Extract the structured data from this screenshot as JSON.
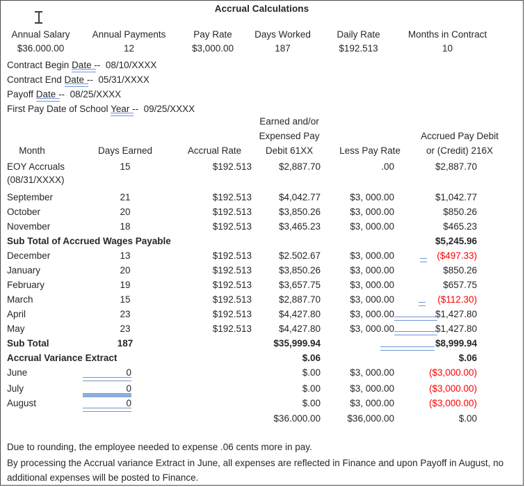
{
  "document": {
    "title": "Accrual Calculations"
  },
  "summary": {
    "headers": [
      "Annual Salary",
      "Annual Payments",
      "Pay Rate",
      "Days Worked",
      "Daily Rate",
      "Months in Contract"
    ],
    "values": [
      "$36.000.00",
      "12",
      "$3,000.00",
      "187",
      "$192.513",
      "10"
    ]
  },
  "dates": [
    {
      "label_before": "Contract Begin ",
      "marked": "Date",
      "sep": " --",
      "value": "08/10/XXXX"
    },
    {
      "label_before": "Contract End ",
      "marked": "Date",
      "sep": " --",
      "value": "05/31/XXXX"
    },
    {
      "label_before": "Payoff ",
      "marked": "Date",
      "sep": " --",
      "value": "08/25/XXXX"
    },
    {
      "label_before": "First Pay Date of School ",
      "marked": "Year",
      "sep": " --",
      "value": "09/25/XXXX"
    }
  ],
  "table": {
    "headers": {
      "month": "Month",
      "days_earned": "Days Earned",
      "accrual_rate": "Accrual Rate",
      "earned_line1": "Earned and/or",
      "earned_line2": "Expensed Pay",
      "earned_line3": "Debit 61XX",
      "less_pay_rate": "Less Pay Rate",
      "accrued_line1": "Accrued Pay Debit",
      "accrued_line2": "or (Credit) 216X"
    },
    "rows": [
      {
        "month": "EOY Accruals",
        "month_line2": "(08/31/XXXX)",
        "days": "15",
        "rate": "$192.513",
        "earned": "$2,887.70",
        "less": ".00",
        "accrued": "$2,887.70",
        "accrued_negative": false
      },
      {
        "month": "September",
        "days": "21",
        "rate": "$192.513",
        "earned": "$4,042.77",
        "less": "$3, 000.00",
        "accrued": "$1,042.77",
        "accrued_negative": false
      },
      {
        "month": "October",
        "days": "20",
        "rate": "$192.513",
        "earned": "$3,850.26",
        "less": "$3, 000.00",
        "accrued": "$850.26",
        "accrued_negative": false
      },
      {
        "month": "November",
        "days": "18",
        "rate": "$192.513",
        "earned": "$3,465.23",
        "less": "$3, 000.00",
        "accrued": "$465.23",
        "accrued_negative": false
      },
      {
        "month": "December",
        "days": "13",
        "rate": "$192.513",
        "earned": "$2.502.67",
        "less": "$3, 000.00",
        "accrued": "($497.33)",
        "accrued_negative": true
      },
      {
        "month": "January",
        "days": "20",
        "rate": "$192.513",
        "earned": "$3,850.26",
        "less": "$3, 000.00",
        "accrued": "$850.26",
        "accrued_negative": false
      },
      {
        "month": "February",
        "days": "19",
        "rate": "$192.513",
        "earned": "$3,657.75",
        "less": "$3, 000.00",
        "accrued": "$657.75",
        "accrued_negative": false
      },
      {
        "month": "March",
        "days": "15",
        "rate": "$192.513",
        "earned": "$2,887.70",
        "less": "$3, 000.00",
        "accrued": "($112.30)",
        "accrued_negative": true
      },
      {
        "month": "April",
        "days": "23",
        "rate": "$192.513",
        "earned": "$4,427.80",
        "less": "$3, 000.00",
        "accrued": "$1,427.80",
        "accrued_negative": false
      },
      {
        "month": "May",
        "days": "23",
        "rate": "$192.513",
        "earned": "$4,427.80",
        "less": "$3, 000.00",
        "accrued": "$1,427.80",
        "accrued_negative": false
      },
      {
        "month": "June",
        "days": "0",
        "rate": "",
        "earned": "$.00",
        "less": "$3, 000.00",
        "accrued": "($3,000.00)",
        "accrued_negative": true
      },
      {
        "month": "July",
        "days": "0",
        "rate": "",
        "earned": "$.00",
        "less": "$3, 000.00",
        "accrued": "($3,000.00)",
        "accrued_negative": true
      },
      {
        "month": "August",
        "days": "0",
        "rate": "",
        "earned": "$.00",
        "less": "$3, 000.00",
        "accrued": "($3,000.00)",
        "accrued_negative": true
      }
    ],
    "subtotal_accrued_wages": {
      "label": "Sub Total of Accrued Wages Payable",
      "accrued": "$5,245.96"
    },
    "subtotal": {
      "label": "Sub Total",
      "days": "187",
      "earned": "$35,999.94",
      "accrued": "$8,999.94"
    },
    "variance_extract": {
      "label": "Accrual Variance Extract",
      "earned": "$.06",
      "accrued": "$.06"
    },
    "grand_total": {
      "earned": "$36.000.00",
      "less": "$36,000.00",
      "accrued": "$.00"
    }
  },
  "notes": [
    "Due to rounding, the employee needed to expense .06 cents more in pay.",
    "By processing the Accrual variance Extract in June, all expenses are reflected in Finance and upon Payoff in August, no",
    "additional expenses will be posted to Finance."
  ],
  "colors": {
    "negative": "#ff0000",
    "tracked_change_underline": "#6f93d6",
    "text": "#262626"
  }
}
